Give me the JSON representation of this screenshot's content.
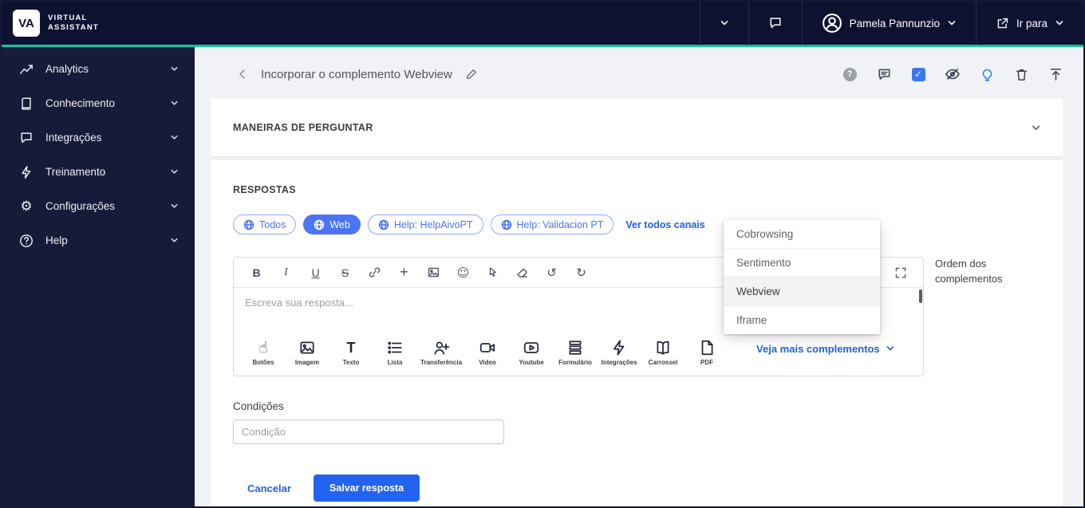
{
  "topbar": {
    "logo": "VA",
    "brand_line1": "VIRTUAL",
    "brand_line2": "ASSISTANT",
    "user_name": "Pamela Pannunzio",
    "go_to_label": "Ir para"
  },
  "sidebar": {
    "items": [
      {
        "label": "Analytics",
        "icon": "analytics"
      },
      {
        "label": "Conhecimento",
        "icon": "book"
      },
      {
        "label": "Integrações",
        "icon": "chat-bubble"
      },
      {
        "label": "Treinamento",
        "icon": "lightning"
      },
      {
        "label": "Configurações",
        "icon": "gear"
      },
      {
        "label": "Help",
        "icon": "question-circle"
      }
    ]
  },
  "page": {
    "title": "Incorporar o complemento Webview"
  },
  "maneiras": {
    "title": "MANEIRAS DE PERGUNTAR"
  },
  "responses": {
    "title": "RESPOSTAS",
    "channels": [
      {
        "label": "Todos",
        "selected": false
      },
      {
        "label": "Web",
        "selected": true
      },
      {
        "label": "Help: HelpAivoPT",
        "selected": false
      },
      {
        "label": "Help: Validacion PT",
        "selected": false
      }
    ],
    "see_all_channels": "Ver todos canais",
    "editor_placeholder": "Escreva sua resposta...",
    "complements": [
      {
        "label": "Botões",
        "icon": "hand-pointer"
      },
      {
        "label": "Imagem",
        "icon": "image"
      },
      {
        "label": "Texto",
        "icon": "text"
      },
      {
        "label": "Lista",
        "icon": "list"
      },
      {
        "label": "Transferência",
        "icon": "transfer-user"
      },
      {
        "label": "Video",
        "icon": "video-camera"
      },
      {
        "label": "Youtube",
        "icon": "youtube-play"
      },
      {
        "label": "Formulário",
        "icon": "form"
      },
      {
        "label": "Integrações",
        "icon": "lightning"
      },
      {
        "label": "Carrossel",
        "icon": "carousel-book"
      },
      {
        "label": "PDF",
        "icon": "pdf-file"
      }
    ],
    "more_complements": "Veja mais complementos",
    "order_label": "Ordem dos complementos"
  },
  "dropdown": {
    "items": [
      "Cobrowsing",
      "Sentimento",
      "Webview",
      "Iframe"
    ],
    "highlighted_item": "Webview"
  },
  "conditions": {
    "label": "Condições",
    "placeholder": "Condição"
  },
  "footer": {
    "cancel_label": "Cancelar",
    "save_label": "Salvar resposta"
  },
  "icons": {
    "question": "?",
    "check": "✓",
    "bold": "B",
    "italic": "I",
    "underline": "U",
    "strike": "S",
    "plus": "+",
    "emoji": "☺",
    "undo": "↺",
    "redo": "↻",
    "pointer_hand": "☝",
    "text_t": "T"
  },
  "colors": {
    "topbar_bg": "#0e1231",
    "sidebar_bg": "#171b3a",
    "accent_teal": "#14c49b",
    "chip_blue": "#4b74f6",
    "link_blue": "#2160e8",
    "save_blue": "#2264f1",
    "main_bg": "#f1f2f5"
  }
}
